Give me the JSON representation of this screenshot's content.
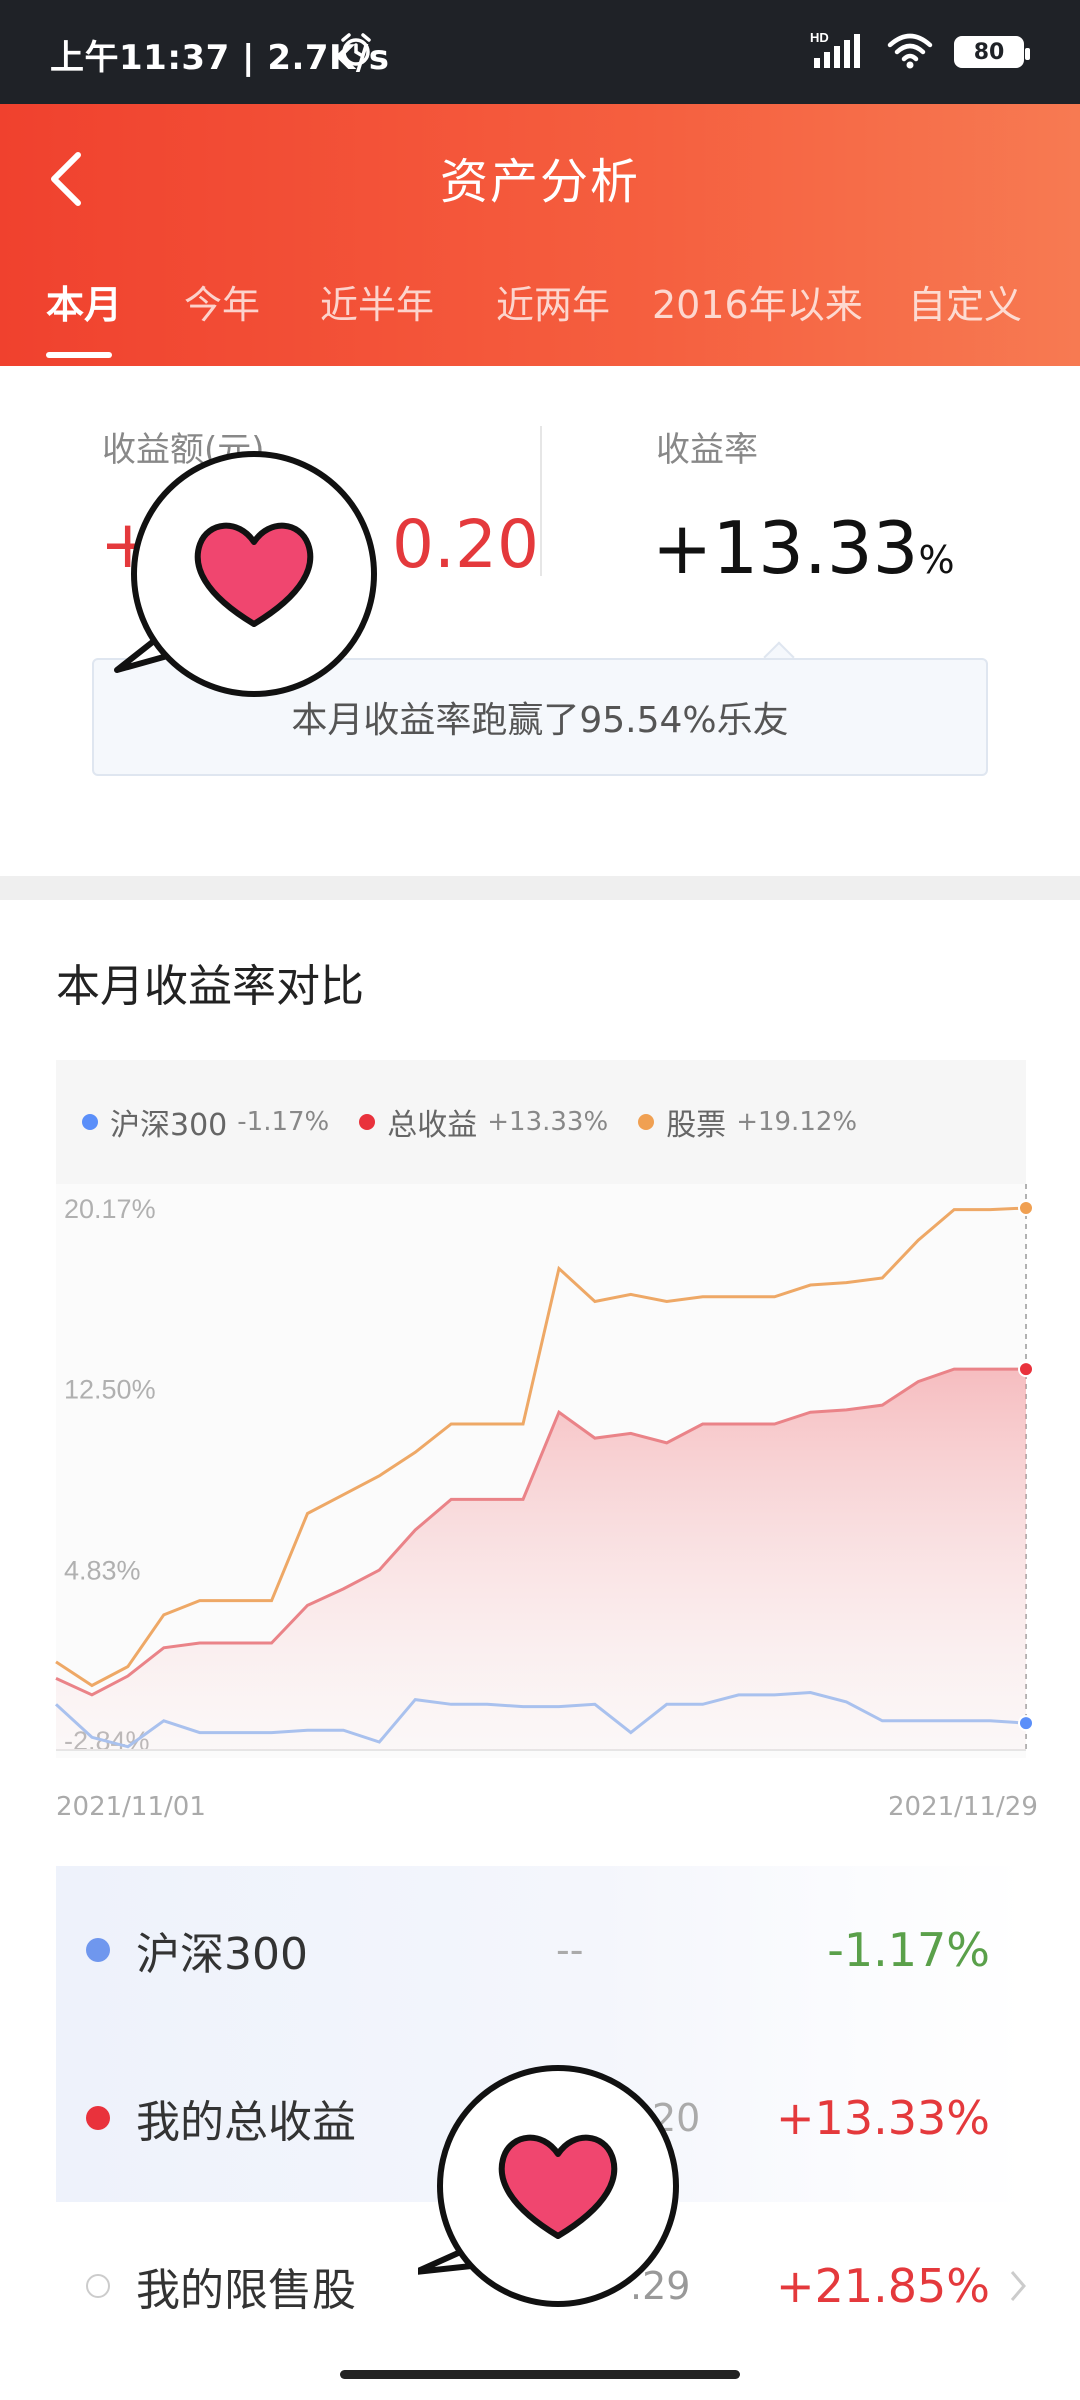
{
  "status_bar": {
    "time": "上午11:37 | 2.7K/s",
    "battery": "80",
    "network": "HD"
  },
  "header": {
    "title": "资产分析",
    "tabs": [
      "本月",
      "今年",
      "近半年",
      "近两年",
      "2016年以来",
      "自定义"
    ],
    "active_tab": "本月"
  },
  "summary": {
    "profit_label": "收益额(元)",
    "profit_value_visible_start": "+",
    "profit_value_visible_end": "0.20",
    "rate_label": "收益率",
    "rate_value": "+13.33",
    "rate_unit": "%",
    "beat_text": "本月收益率跑赢了95.54%乐友"
  },
  "comparison": {
    "title": "本月收益率对比",
    "legend": [
      {
        "name": "沪深300",
        "value": "-1.17%",
        "color": "#5b8ff9"
      },
      {
        "name": "总收益",
        "value": "+13.33%",
        "color": "#e9323c"
      },
      {
        "name": "股票",
        "value": "+19.12%",
        "color": "#f0a052"
      }
    ],
    "start_date": "2021/11/01",
    "end_date": "2021/11/29"
  },
  "chart_data": {
    "type": "line",
    "title": "",
    "yticks": [
      "20.17%",
      "12.50%",
      "4.83%",
      "-2.84%"
    ],
    "ylim": [
      -2.84,
      20.17
    ],
    "x_start": "2021/11/01",
    "x_end": "2021/11/29",
    "series": [
      {
        "name": "沪深300",
        "color": "#a9c1ee",
        "values": [
          -0.9,
          -2.3,
          -2.7,
          -1.6,
          -2.1,
          -2.1,
          -2.1,
          -2.0,
          -2.0,
          -2.5,
          -0.7,
          -0.9,
          -0.9,
          -1.0,
          -1.0,
          -0.9,
          -2.1,
          -0.9,
          -0.9,
          -0.5,
          -0.5,
          -0.4,
          -0.8,
          -1.6,
          -1.6,
          -1.6,
          -1.6,
          -1.7
        ]
      },
      {
        "name": "总收益",
        "color": "#ea8388",
        "values": [
          0.2,
          -0.5,
          0.3,
          1.5,
          1.7,
          1.7,
          1.7,
          3.3,
          4.0,
          4.8,
          6.5,
          7.8,
          7.8,
          7.8,
          11.5,
          10.4,
          10.6,
          10.2,
          11.0,
          11.0,
          11.0,
          11.5,
          11.6,
          11.8,
          12.8,
          13.33,
          13.33,
          13.33
        ]
      },
      {
        "name": "股票",
        "color": "#eea866",
        "values": [
          0.9,
          -0.1,
          0.7,
          2.9,
          3.5,
          3.5,
          3.5,
          7.2,
          8.0,
          8.8,
          9.8,
          11.0,
          11.0,
          11.0,
          17.6,
          16.2,
          16.5,
          16.2,
          16.4,
          16.4,
          16.4,
          16.9,
          17.0,
          17.2,
          18.8,
          20.1,
          20.1,
          20.17
        ]
      }
    ]
  },
  "list": [
    {
      "name": "沪深300",
      "mid": "--",
      "value": "-1.17%",
      "value_color": "#5aa04a",
      "dot_color": "#6f97ee",
      "dot_style": "filled"
    },
    {
      "name": "我的总收益",
      "mid": "20",
      "value": "+13.33%",
      "value_color": "#e4393c",
      "dot_color": "#e9323c",
      "dot_style": "filled"
    },
    {
      "name": "我的限售股",
      "mid": ".29",
      "value": "+21.85%",
      "value_color": "#e4393c",
      "dot_color": "#cccccc",
      "dot_style": "hollow"
    }
  ]
}
